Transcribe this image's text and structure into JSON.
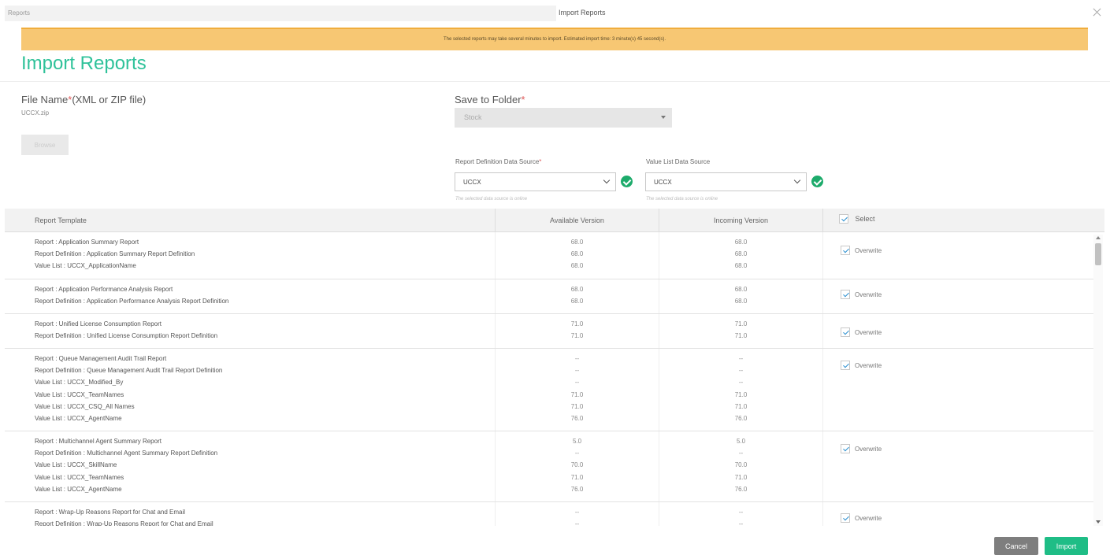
{
  "tabs": {
    "left": "Reports",
    "right": "Import Reports"
  },
  "banner": "The selected reports may take several minutes to import. Estimated import time: 3 minute(s) 45 second(s).",
  "title": "Import Reports",
  "file": {
    "label": "File Name",
    "required_mark": "*",
    "label_suffix": "(XML or ZIP file)",
    "value": "UCCX.zip",
    "browse_label": "Browse"
  },
  "folder": {
    "label": "Save to Folder",
    "required_mark": "*",
    "value": "Stock"
  },
  "report_ds": {
    "label": "Report Definition Data Source",
    "required_mark": "*",
    "value": "UCCX",
    "note": "The selected data source is online"
  },
  "value_ds": {
    "label": "Value List Data Source",
    "value": "UCCX",
    "note": "The selected data source is online"
  },
  "table": {
    "headers": {
      "template": "Report Template",
      "available": "Available Version",
      "incoming": "Incoming Version",
      "select": "Select"
    },
    "overwrite_label": "Overwrite",
    "rows": [
      {
        "lines": [
          "Report : Application Summary Report",
          "Report Definition : Application Summary Report Definition",
          "Value List : UCCX_ApplicationName"
        ],
        "available": [
          "68.0",
          "68.0",
          "68.0"
        ],
        "incoming": [
          "68.0",
          "68.0",
          "68.0"
        ]
      },
      {
        "lines": [
          "Report : Application Performance Analysis Report",
          "Report Definition : Application Performance Analysis Report Definition"
        ],
        "available": [
          "68.0",
          "68.0"
        ],
        "incoming": [
          "68.0",
          "68.0"
        ]
      },
      {
        "lines": [
          "Report : Unified License Consumption Report",
          "Report Definition : Unified License Consumption Report Definition"
        ],
        "available": [
          "71.0",
          "71.0"
        ],
        "incoming": [
          "71.0",
          "71.0"
        ]
      },
      {
        "lines": [
          "Report : Queue Management Audit Trail Report",
          "Report Definition : Queue Management Audit Trail Report Definition",
          "Value List : UCCX_Modified_By",
          "Value List : UCCX_TeamNames",
          "Value List : UCCX_CSQ_All Names",
          "Value List : UCCX_AgentName"
        ],
        "available": [
          "--",
          "--",
          "--",
          "71.0",
          "71.0",
          "76.0"
        ],
        "incoming": [
          "--",
          "--",
          "--",
          "71.0",
          "71.0",
          "76.0"
        ]
      },
      {
        "lines": [
          "Report : Multichannel Agent Summary Report",
          "Report Definition : Multichannel Agent Summary Report Definition",
          "Value List : UCCX_SkillName",
          "Value List : UCCX_TeamNames",
          "Value List : UCCX_AgentName"
        ],
        "available": [
          "5.0",
          "--",
          "70.0",
          "71.0",
          "76.0"
        ],
        "incoming": [
          "5.0",
          "--",
          "70.0",
          "71.0",
          "76.0"
        ]
      },
      {
        "lines": [
          "Report : Wrap-Up Reasons Report for Chat and Email",
          "Report Definition : Wrap-Up Reasons Report for Chat and Email"
        ],
        "available": [
          "--",
          "--"
        ],
        "incoming": [
          "--",
          "--"
        ]
      }
    ]
  },
  "buttons": {
    "cancel": "Cancel",
    "import": "Import"
  },
  "colors": {
    "accent": "#2fc29a",
    "banner": "#f7c773",
    "ok": "#1dab6b",
    "import": "#1fbd86",
    "cancel": "#7e7e7e"
  }
}
